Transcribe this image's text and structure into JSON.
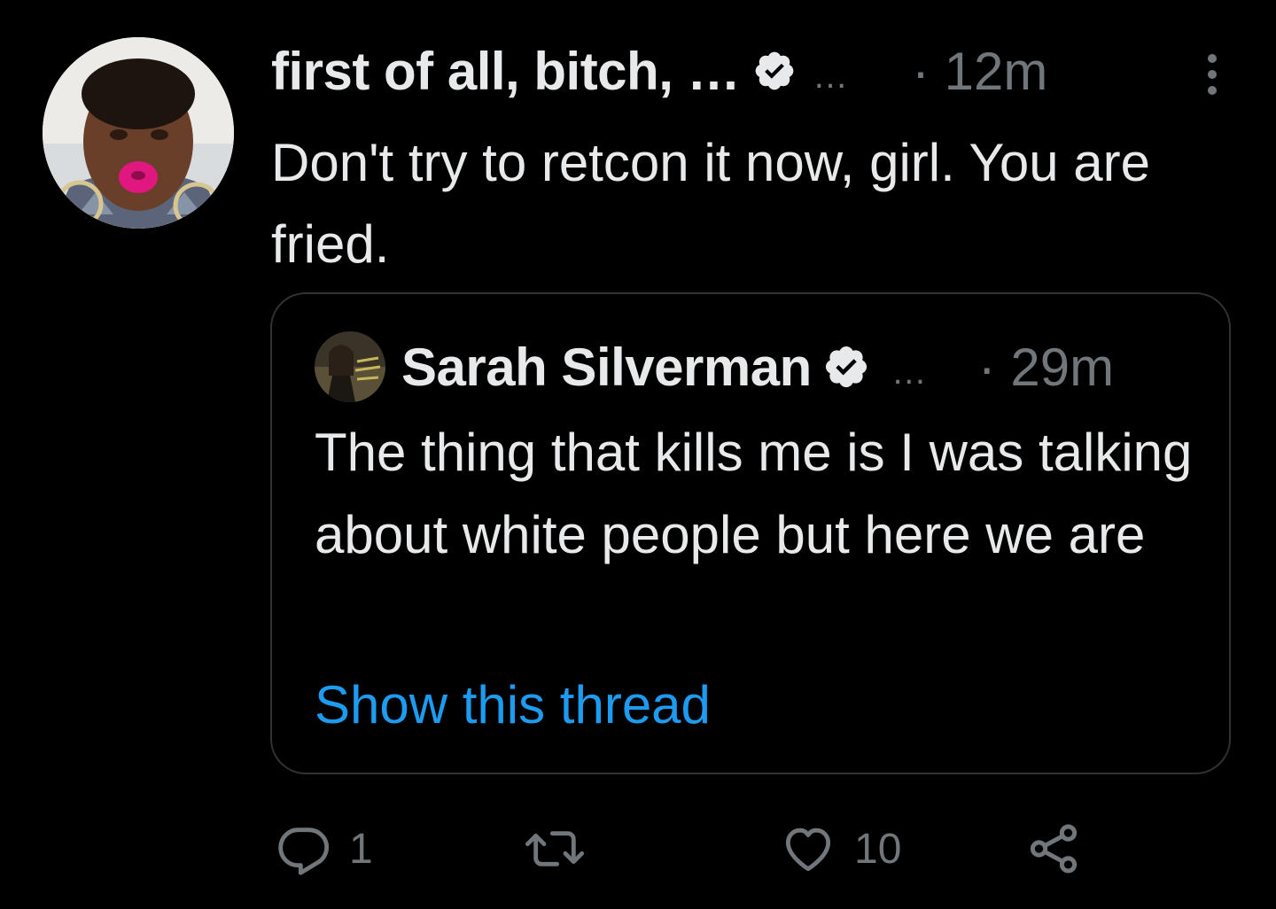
{
  "colors": {
    "background": "#000000",
    "text": "#e7e9ea",
    "muted": "#71767b",
    "link": "#1d9bf0",
    "border": "#2f3336"
  },
  "tweet": {
    "author_name": "first of all, bitch, …",
    "verified_icon": "verified-badge-icon",
    "ellipsis": "…",
    "time": "· 12m",
    "more_icon": "more-vertical-icon",
    "text": "Don't try to retcon it now, girl. You are fried."
  },
  "quote": {
    "author_name": "Sarah Silverman",
    "verified_icon": "verified-badge-icon",
    "ellipsis": "…",
    "time": "· 29m",
    "text": "The thing that kills me is I was talking about white people but here we are",
    "link": "Show this thread"
  },
  "actions": {
    "reply": {
      "icon": "reply-icon",
      "count": "1"
    },
    "retweet": {
      "icon": "retweet-icon",
      "count": ""
    },
    "like": {
      "icon": "heart-icon",
      "count": "10"
    },
    "share": {
      "icon": "share-icon"
    }
  }
}
